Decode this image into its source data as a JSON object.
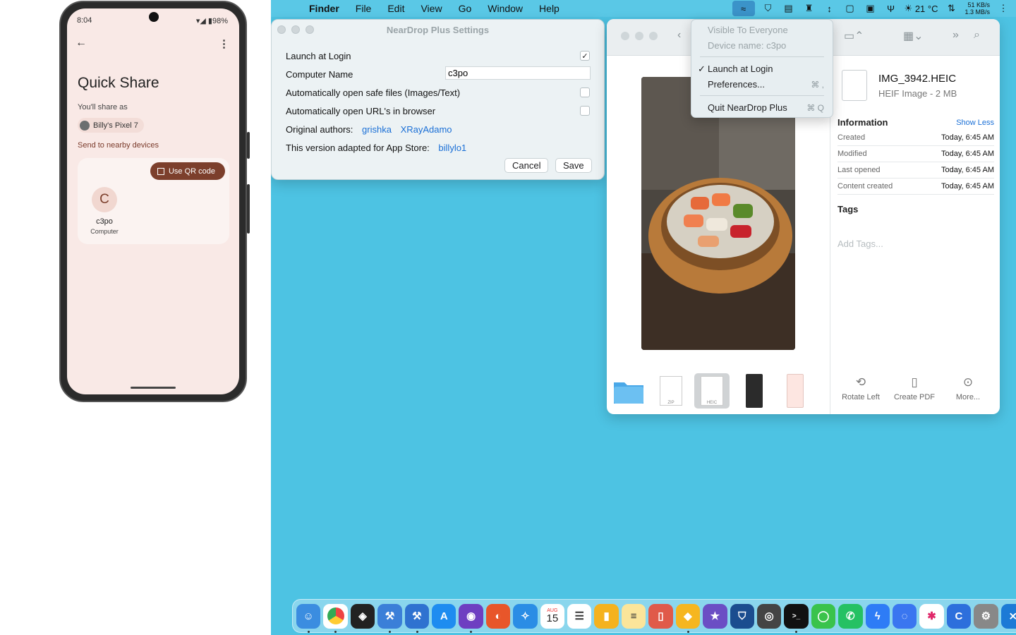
{
  "phone": {
    "status_time": "8:04",
    "status_right": "98%",
    "title": "Quick Share",
    "share_as_label": "You'll share as",
    "device_chip": "Billy's Pixel 7",
    "send_label": "Send to nearby devices",
    "qr_button": "Use QR code",
    "nearby_device": {
      "initial": "C",
      "name": "c3po",
      "type": "Computer"
    }
  },
  "menubar": {
    "app": "Finder",
    "items": [
      "File",
      "Edit",
      "View",
      "Go",
      "Window",
      "Help"
    ],
    "temperature": "21 °C",
    "net_up": "51 KB/s",
    "net_down": "1.3 MB/s"
  },
  "status_menu": {
    "visible": "Visible To Everyone",
    "device_name": "Device name: c3po",
    "launch": "Launch at Login",
    "preferences": "Preferences...",
    "preferences_shortcut": "⌘ ,",
    "quit": "Quit NearDrop Plus",
    "quit_shortcut": "⌘ Q"
  },
  "settings": {
    "title": "NearDrop Plus Settings",
    "launch_label": "Launch at Login",
    "launch_checked": true,
    "computer_name_label": "Computer Name",
    "computer_name_value": "c3po",
    "auto_open_files_label": "Automatically open safe files (Images/Text)",
    "auto_open_files_checked": false,
    "auto_open_urls_label": "Automatically open URL's in browser",
    "auto_open_urls_checked": false,
    "authors_label": "Original authors:",
    "author1": "grishka",
    "author2": "XRayAdamo",
    "adapted_label": "This version adapted for App Store:",
    "adapted_author": "billylo1",
    "cancel": "Cancel",
    "save": "Save"
  },
  "finder": {
    "file_name": "IMG_3942.HEIC",
    "file_type": "HEIF Image - 2 MB",
    "info_title": "Information",
    "show_less": "Show Less",
    "info_rows": [
      {
        "key": "Created",
        "value": "Today, 6:45 AM"
      },
      {
        "key": "Modified",
        "value": "Today, 6:45 AM"
      },
      {
        "key": "Last opened",
        "value": "Today, 6:45 AM"
      },
      {
        "key": "Content created",
        "value": "Today, 6:45 AM"
      }
    ],
    "tags_title": "Tags",
    "tags_placeholder": "Add Tags...",
    "actions": [
      "Rotate Left",
      "Create PDF",
      "More..."
    ],
    "thumb_labels": [
      "ZIP",
      "HEIC"
    ]
  },
  "dock": {
    "calendar_month": "AUG",
    "calendar_day": "15"
  },
  "colors": {
    "desktop": "#4dc3e3",
    "phone_bg": "#f9e9e6",
    "accent_brown": "#7c3f2c",
    "link_blue": "#1a6fd6"
  }
}
